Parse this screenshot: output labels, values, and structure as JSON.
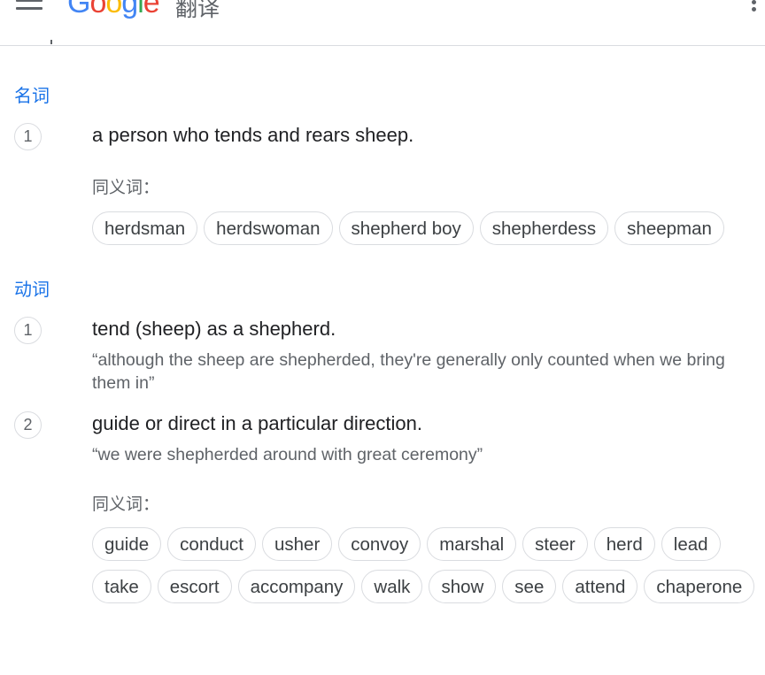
{
  "header": {
    "logo_letters": [
      {
        "ch": "G",
        "color": "#4285F4"
      },
      {
        "ch": "o",
        "color": "#EA4335"
      },
      {
        "ch": "o",
        "color": "#FBBC05"
      },
      {
        "ch": "g",
        "color": "#4285F4"
      },
      {
        "ch": "l",
        "color": "#34A853"
      },
      {
        "ch": "e",
        "color": "#EA4335"
      }
    ],
    "product": "翻译",
    "menu_icon": "hamburger-menu-icon",
    "apps_icon": "apps-grid-icon"
  },
  "noun": {
    "pos_label": "名词",
    "definitions": [
      {
        "number": "1",
        "text": "a person who tends and rears sheep.",
        "synonyms_label": "同义词：",
        "synonyms": [
          "herdsman",
          "herdswoman",
          "shepherd boy",
          "shepherdess",
          "sheepman"
        ]
      }
    ]
  },
  "verb": {
    "pos_label": "动词",
    "definitions": [
      {
        "number": "1",
        "text": "tend (sheep) as a shepherd.",
        "example": "“although the sheep are shepherded, they're generally only counted when we bring them in”"
      },
      {
        "number": "2",
        "text": "guide or direct in a particular direction.",
        "example": "“we were shepherded around with great ceremony”",
        "synonyms_label": "同义词：",
        "synonyms": [
          "guide",
          "conduct",
          "usher",
          "convoy",
          "marshal",
          "steer",
          "herd",
          "lead",
          "take",
          "escort",
          "accompany",
          "walk",
          "show",
          "see",
          "attend",
          "chaperone"
        ]
      }
    ]
  },
  "colors": {
    "accent": "#1a73e8",
    "text": "#202124",
    "secondary": "#5f6368",
    "border": "#dadce0"
  }
}
